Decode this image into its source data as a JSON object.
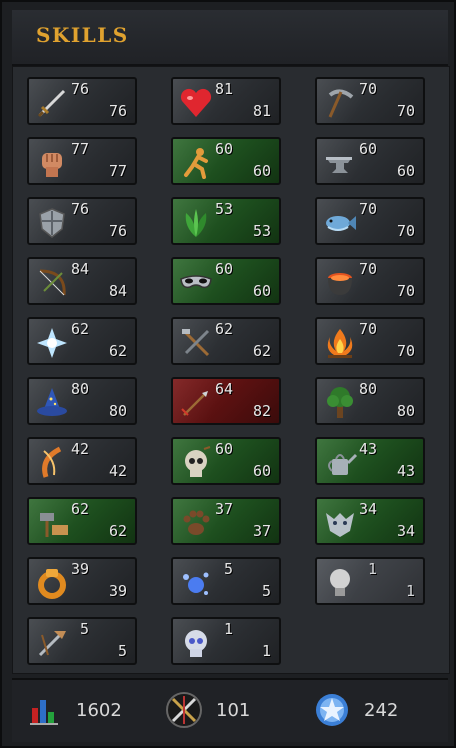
{
  "panel": {
    "title": "SKILLS"
  },
  "skills": [
    {
      "id": "attack",
      "icon": "sword-icon",
      "level": "76",
      "max": "76",
      "style": "normal"
    },
    {
      "id": "constitution",
      "icon": "heart-icon",
      "level": "81",
      "max": "81",
      "style": "normal"
    },
    {
      "id": "mining",
      "icon": "pickaxe-icon",
      "level": "70",
      "max": "70",
      "style": "normal"
    },
    {
      "id": "strength",
      "icon": "fist-icon",
      "level": "77",
      "max": "77",
      "style": "normal"
    },
    {
      "id": "agility",
      "icon": "running-man-icon",
      "level": "60",
      "max": "60",
      "style": "green"
    },
    {
      "id": "smithing",
      "icon": "anvil-icon",
      "level": "60",
      "max": "60",
      "style": "normal"
    },
    {
      "id": "defence",
      "icon": "shield-icon",
      "level": "76",
      "max": "76",
      "style": "normal"
    },
    {
      "id": "herblore",
      "icon": "herb-leaves-icon",
      "level": "53",
      "max": "53",
      "style": "green"
    },
    {
      "id": "fishing",
      "icon": "fish-icon",
      "level": "70",
      "max": "70",
      "style": "normal"
    },
    {
      "id": "ranged",
      "icon": "bow-icon",
      "level": "84",
      "max": "84",
      "style": "normal"
    },
    {
      "id": "thieving",
      "icon": "mask-icon",
      "level": "60",
      "max": "60",
      "style": "green"
    },
    {
      "id": "cooking",
      "icon": "cooking-pot-icon",
      "level": "70",
      "max": "70",
      "style": "normal"
    },
    {
      "id": "prayer",
      "icon": "prayer-star-icon",
      "level": "62",
      "max": "62",
      "style": "normal"
    },
    {
      "id": "crafting",
      "icon": "crafting-tools-icon",
      "level": "62",
      "max": "62",
      "style": "normal"
    },
    {
      "id": "firemaking",
      "icon": "campfire-icon",
      "level": "70",
      "max": "70",
      "style": "normal"
    },
    {
      "id": "magic",
      "icon": "wizard-hat-icon",
      "level": "80",
      "max": "80",
      "style": "normal"
    },
    {
      "id": "fletching",
      "icon": "arrows-icon",
      "level": "64",
      "max": "82",
      "style": "red"
    },
    {
      "id": "woodcutting",
      "icon": "tree-icon",
      "level": "80",
      "max": "80",
      "style": "normal"
    },
    {
      "id": "runecrafting",
      "icon": "rune-icon",
      "level": "42",
      "max": "42",
      "style": "normal"
    },
    {
      "id": "slayer",
      "icon": "skull-icon",
      "level": "60",
      "max": "60",
      "style": "green"
    },
    {
      "id": "farming",
      "icon": "watering-can-icon",
      "level": "43",
      "max": "43",
      "style": "green"
    },
    {
      "id": "construction",
      "icon": "hammer-saw-icon",
      "level": "62",
      "max": "62",
      "style": "green"
    },
    {
      "id": "hunter",
      "icon": "paw-print-icon",
      "level": "37",
      "max": "37",
      "style": "green"
    },
    {
      "id": "summoning",
      "icon": "wolf-head-icon",
      "level": "34",
      "max": "34",
      "style": "green"
    },
    {
      "id": "dungeoneering",
      "icon": "ring-icon",
      "level": "39",
      "max": "39",
      "style": "normal"
    },
    {
      "id": "divination",
      "icon": "energy-orbs-icon",
      "level": "5",
      "max": "5",
      "style": "normal"
    },
    {
      "id": "invention",
      "icon": "light-bulb-icon",
      "level": "1",
      "max": "1",
      "style": "disabled"
    },
    {
      "id": "archaeology",
      "icon": "archaeology-tools-icon",
      "level": "5",
      "max": "5",
      "style": "normal"
    },
    {
      "id": "necromancy",
      "icon": "skull-blue-icon",
      "level": "1",
      "max": "1",
      "style": "normal"
    }
  ],
  "footer": {
    "total_level": "1602",
    "total_icon": "bar-chart-icon",
    "combat_level": "101",
    "combat_icon": "crossed-swords-icon",
    "quest_points": "242",
    "quest_icon": "quest-star-icon"
  }
}
